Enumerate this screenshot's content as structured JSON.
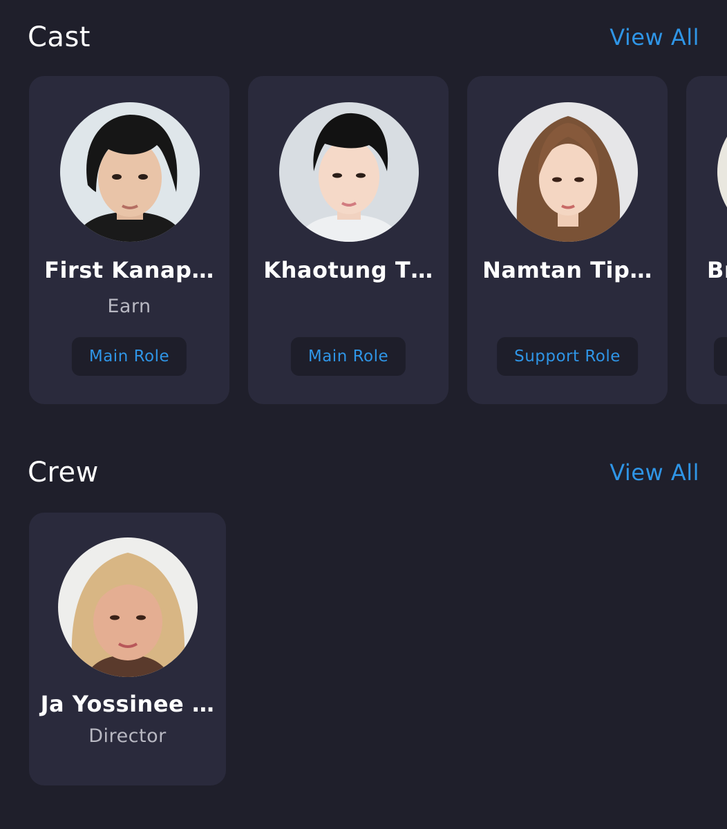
{
  "cast": {
    "title": "Cast",
    "view_all": "View All",
    "members": [
      {
        "name": "First Kanap…",
        "character": "Earn",
        "role": "Main Role"
      },
      {
        "name": "Khaotung T…",
        "character": "",
        "role": "Main Role"
      },
      {
        "name": "Namtan Tip…",
        "character": "",
        "role": "Support Role"
      },
      {
        "name": "Br",
        "character": "",
        "role": ""
      }
    ]
  },
  "crew": {
    "title": "Crew",
    "view_all": "View All",
    "members": [
      {
        "name": "Ja Yossinee …",
        "job": "Director"
      }
    ]
  },
  "colors": {
    "background": "#1f1f2b",
    "card": "#2a2a3c",
    "accent": "#2f95e6",
    "badge": "#1e1e2a",
    "muted_text": "#b8b8c2"
  }
}
